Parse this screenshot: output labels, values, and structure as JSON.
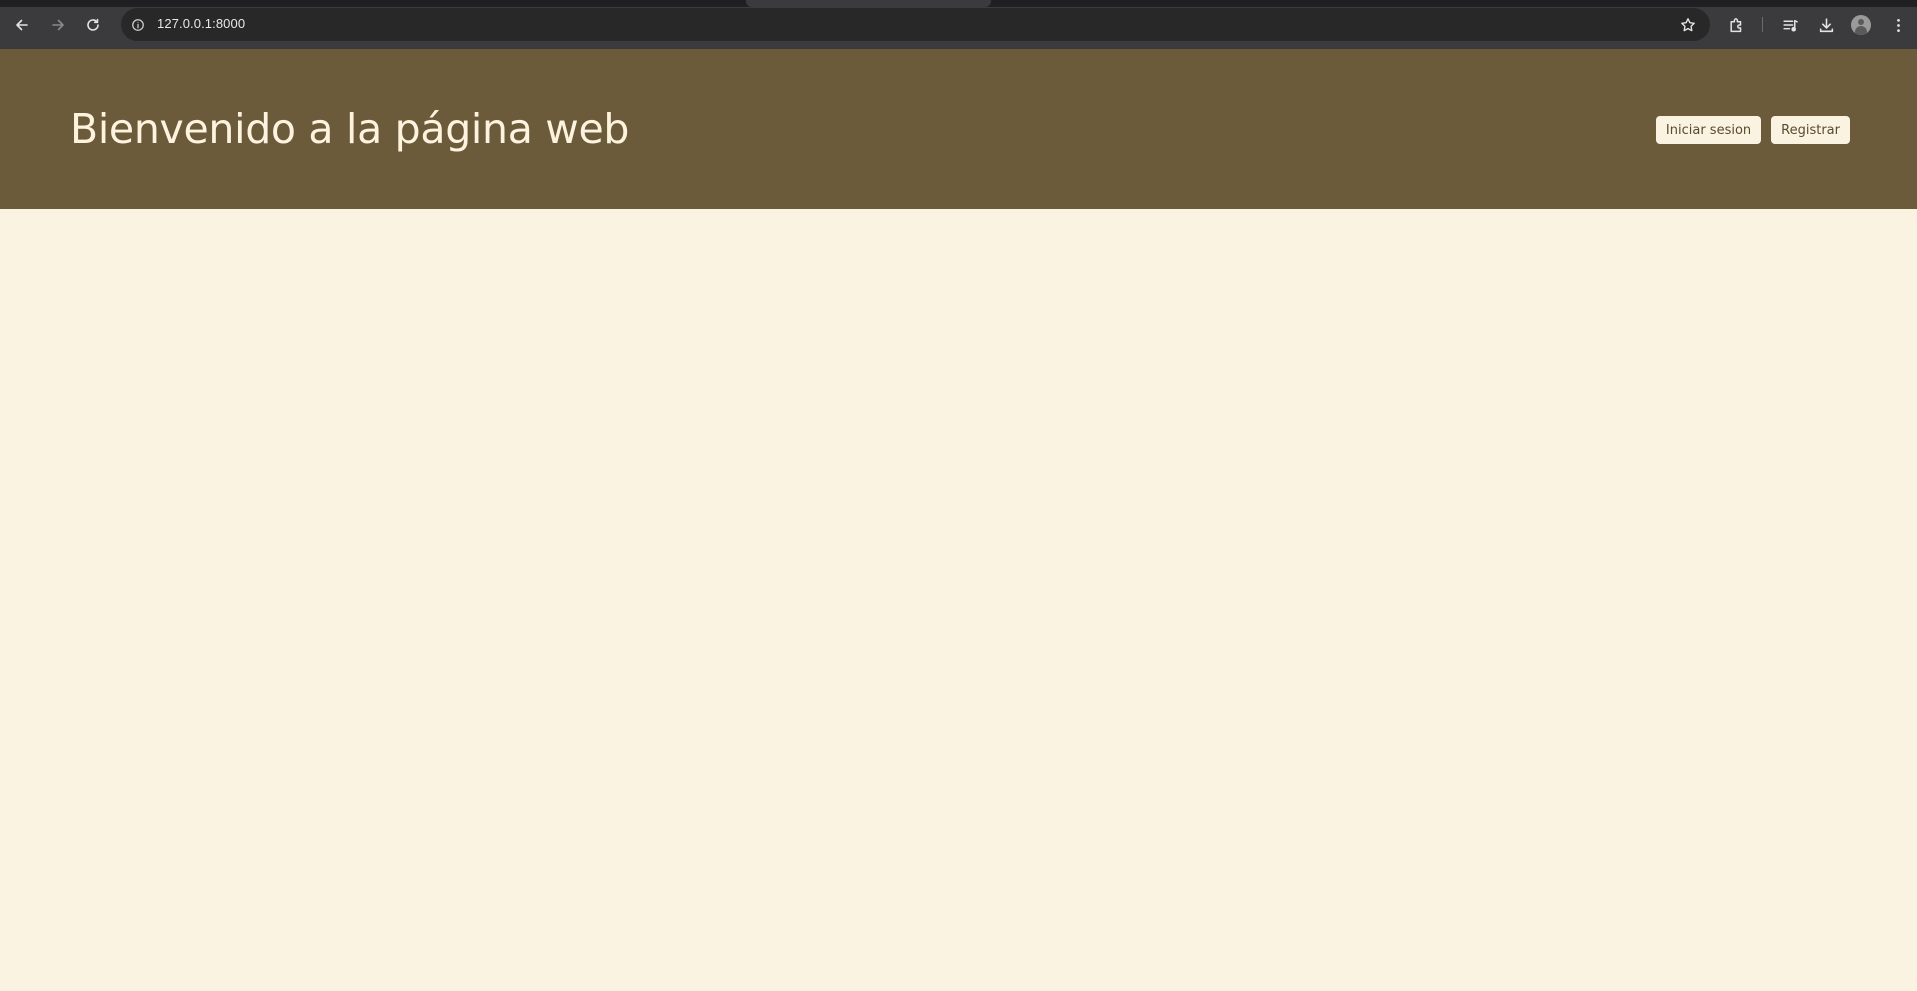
{
  "browser": {
    "url": "127.0.0.1:8000",
    "icons": {
      "back": "arrow-left-icon",
      "forward": "arrow-right-icon",
      "reload": "reload-icon",
      "site_info": "info-circle-icon",
      "bookmark": "star-icon",
      "extensions": "puzzle-icon",
      "media": "media-queue-icon",
      "downloads": "download-icon",
      "profile": "avatar-icon",
      "menu": "kebab-menu-icon"
    },
    "colors": {
      "toolbar": "#3b3b3d",
      "omnibox": "#282828"
    }
  },
  "header": {
    "title": "Bienvenido a la página web",
    "login_label": "Iniciar sesion",
    "register_label": "Registrar"
  },
  "colors": {
    "header_background": "#6b5b3a",
    "page_background": "#fbf3e2",
    "title_text": "#fdf3df",
    "button_background": "#fbf3e2",
    "button_text": "#5a4a2c"
  }
}
